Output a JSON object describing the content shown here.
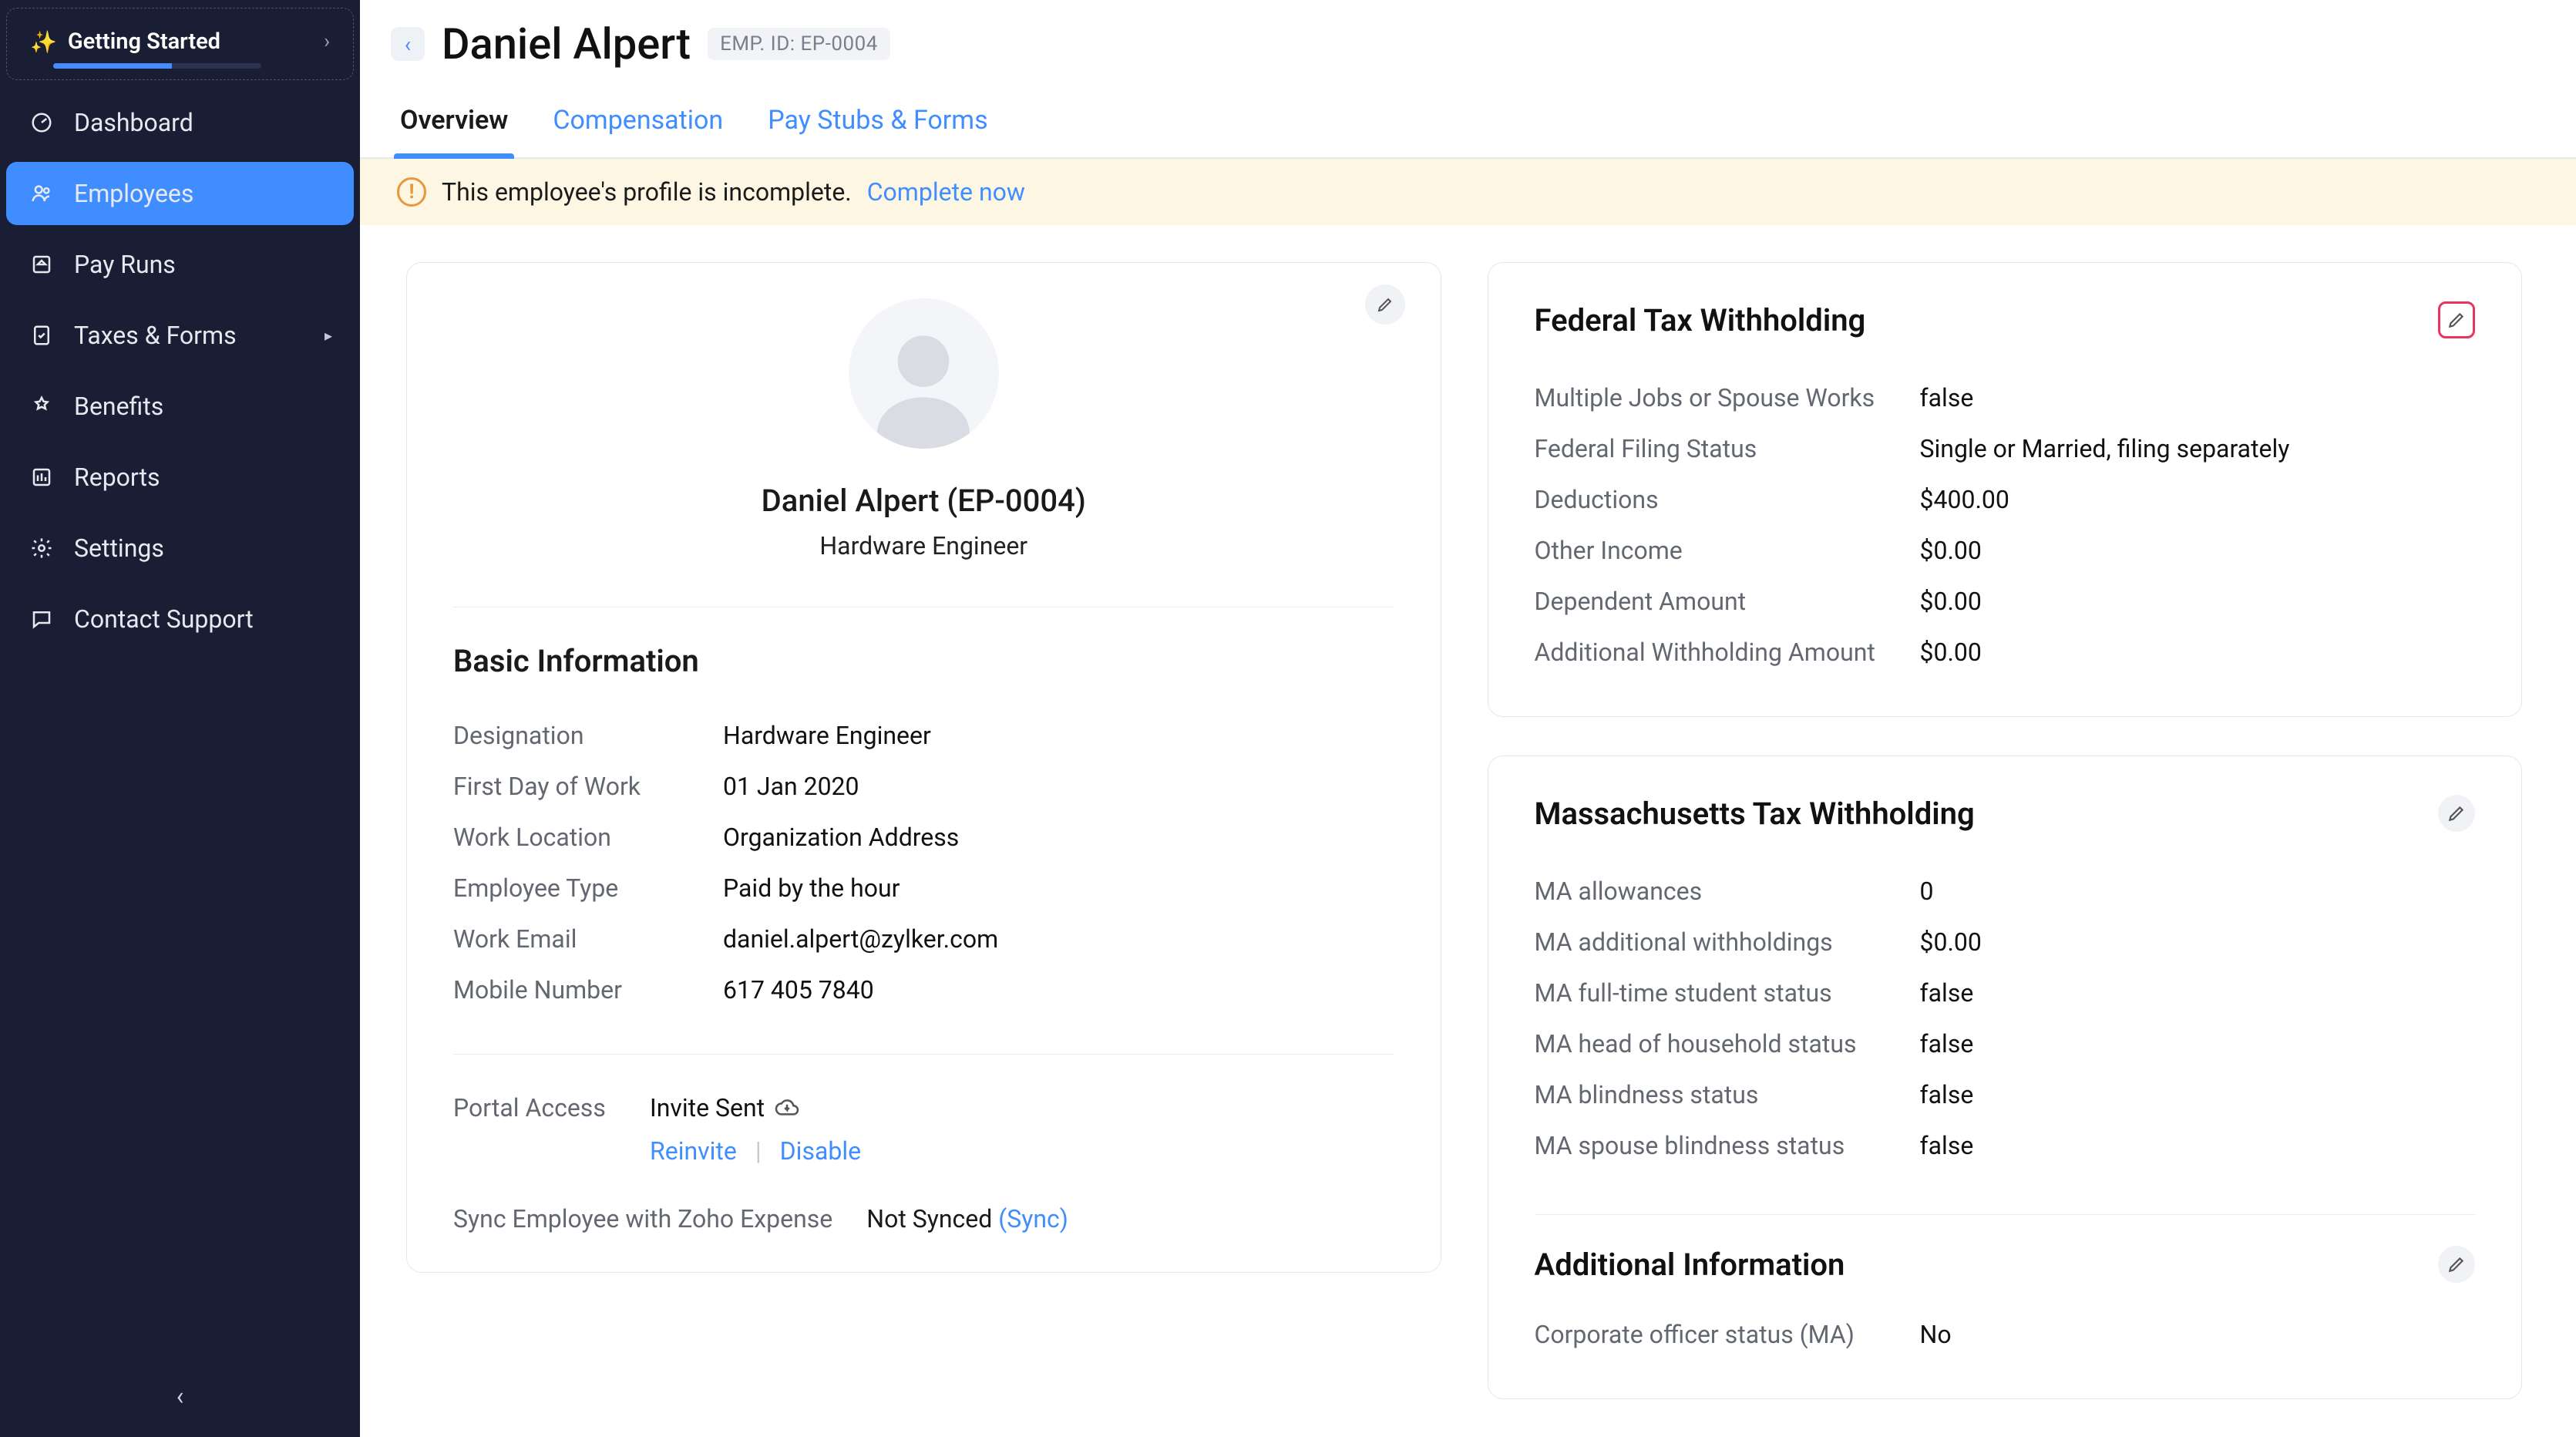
{
  "getting_started": {
    "label": "Getting Started"
  },
  "sidebar": {
    "items": [
      {
        "label": "Dashboard"
      },
      {
        "label": "Employees"
      },
      {
        "label": "Pay Runs"
      },
      {
        "label": "Taxes & Forms"
      },
      {
        "label": "Benefits"
      },
      {
        "label": "Reports"
      },
      {
        "label": "Settings"
      },
      {
        "label": "Contact Support"
      }
    ]
  },
  "header": {
    "name": "Daniel Alpert",
    "badge": "EMP. ID: EP-0004"
  },
  "tabs": {
    "overview": "Overview",
    "compensation": "Compensation",
    "paystubs": "Pay Stubs & Forms"
  },
  "alert": {
    "text": "This employee's profile is incomplete.",
    "action": "Complete now"
  },
  "profile": {
    "name_line": "Daniel Alpert (EP-0004)",
    "title": "Hardware Engineer"
  },
  "basic": {
    "heading": "Basic Information",
    "designation_l": "Designation",
    "designation_v": "Hardware Engineer",
    "first_day_l": "First Day of Work",
    "first_day_v": "01 Jan 2020",
    "work_loc_l": "Work Location",
    "work_loc_v": "Organization Address",
    "emp_type_l": "Employee Type",
    "emp_type_v": "Paid by the hour",
    "work_email_l": "Work Email",
    "work_email_v": "daniel.alpert@zylker.com",
    "mobile_l": "Mobile Number",
    "mobile_v": "617 405 7840"
  },
  "portal": {
    "label": "Portal Access",
    "status": "Invite Sent",
    "reinvite": "Reinvite",
    "disable": "Disable"
  },
  "sync": {
    "label": "Sync Employee with Zoho Expense",
    "status": "Not Synced",
    "action": "(Sync)"
  },
  "federal": {
    "heading": "Federal Tax Withholding",
    "r1l": "Multiple Jobs or Spouse Works",
    "r1v": "false",
    "r2l": "Federal Filing Status",
    "r2v": "Single or Married, filing separately",
    "r3l": "Deductions",
    "r3v": "$400.00",
    "r4l": "Other Income",
    "r4v": "$0.00",
    "r5l": "Dependent Amount",
    "r5v": "$0.00",
    "r6l": "Additional Withholding Amount",
    "r6v": "$0.00"
  },
  "mass": {
    "heading": "Massachusetts Tax Withholding",
    "r1l": "MA allowances",
    "r1v": "0",
    "r2l": "MA additional withholdings",
    "r2v": "$0.00",
    "r3l": "MA full-time student status",
    "r3v": "false",
    "r4l": "MA head of household status",
    "r4v": "false",
    "r5l": "MA blindness status",
    "r5v": "false",
    "r6l": "MA spouse blindness status",
    "r6v": "false"
  },
  "additional": {
    "heading": "Additional Information",
    "r1l": "Corporate officer status (MA)",
    "r1v": "No"
  }
}
